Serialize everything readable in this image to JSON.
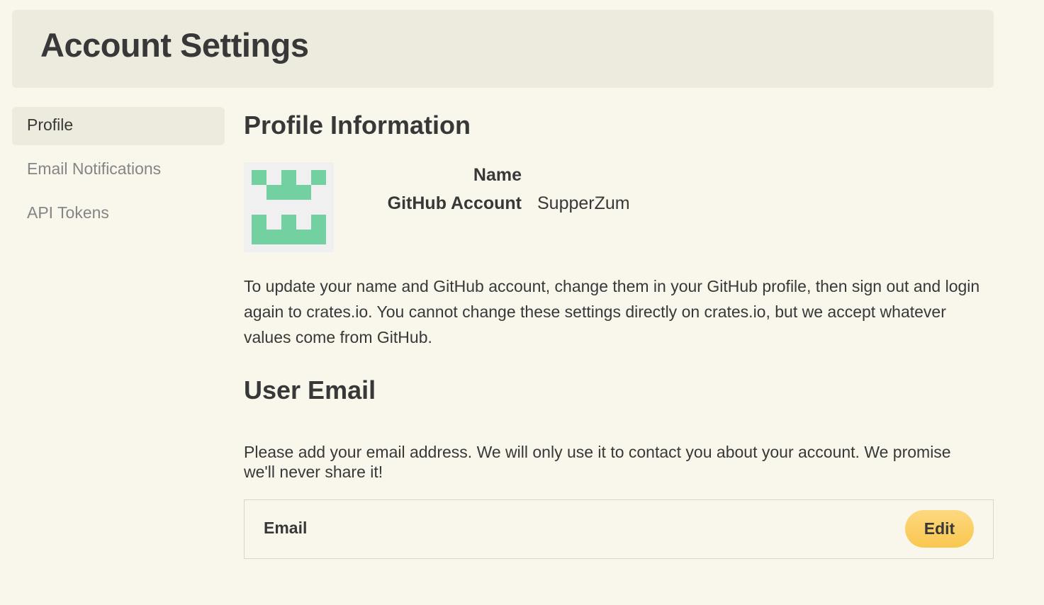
{
  "header": {
    "title": "Account Settings"
  },
  "sidebar": {
    "items": [
      {
        "label": "Profile",
        "active": true
      },
      {
        "label": "Email Notifications",
        "active": false
      },
      {
        "label": "API Tokens",
        "active": false
      }
    ]
  },
  "profile": {
    "title": "Profile Information",
    "avatar_icon": "identicon-avatar",
    "avatar_color": "#73d0a0",
    "fields": [
      {
        "label": "Name",
        "value": ""
      },
      {
        "label": "GitHub Account",
        "value": "SupperZum"
      }
    ],
    "update_text": "To update your name and GitHub account, change them in your GitHub profile, then sign out and login again to crates.io. You cannot change these settings directly on crates.io, but we accept whatever values come from GitHub."
  },
  "user_email": {
    "title": "User Email",
    "description": "Please add your email address. We will only use it to contact you about your account. We promise we'll never share it!",
    "email_label": "Email",
    "edit_label": "Edit"
  },
  "colors": {
    "background": "#f9f7ec",
    "panel": "#edebdd",
    "accent": "#fdd87f",
    "text": "#383838",
    "muted": "#858585"
  }
}
